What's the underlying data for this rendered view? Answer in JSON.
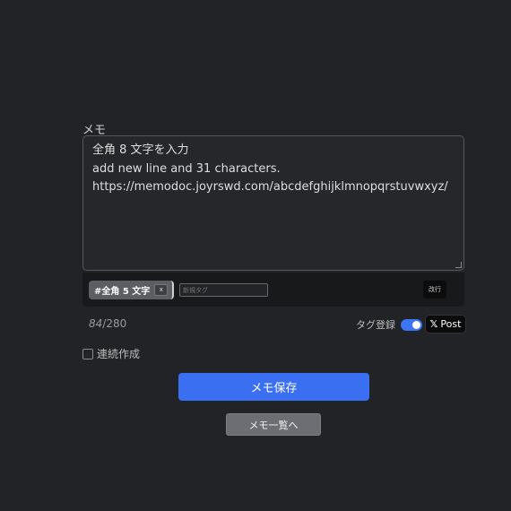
{
  "memo": {
    "label": "メモ",
    "lines": [
      "全角 8 文字を入力",
      "add new line and 31 characters.",
      "https://memodoc.joyrswd.com/abcdefghijklmnopqrstuvwxyz/"
    ]
  },
  "tags": {
    "chip_label": "#全角 5 文字",
    "remove_label": "x",
    "new_tag_placeholder": "新規タグ",
    "newline_label": "改行"
  },
  "counter": {
    "current": "84",
    "separator": "/",
    "max": "280"
  },
  "tag_register": {
    "label": "タグ登録",
    "enabled": true
  },
  "x_post": {
    "logo": "𝕏",
    "label": "Post"
  },
  "continuous": {
    "label": "連続作成",
    "checked": false
  },
  "actions": {
    "save_label": "メモ保存",
    "list_label": "メモ一覧へ"
  },
  "colors": {
    "background": "#222326",
    "primary": "#3a6ff2",
    "toggle": "#3d74f5"
  }
}
